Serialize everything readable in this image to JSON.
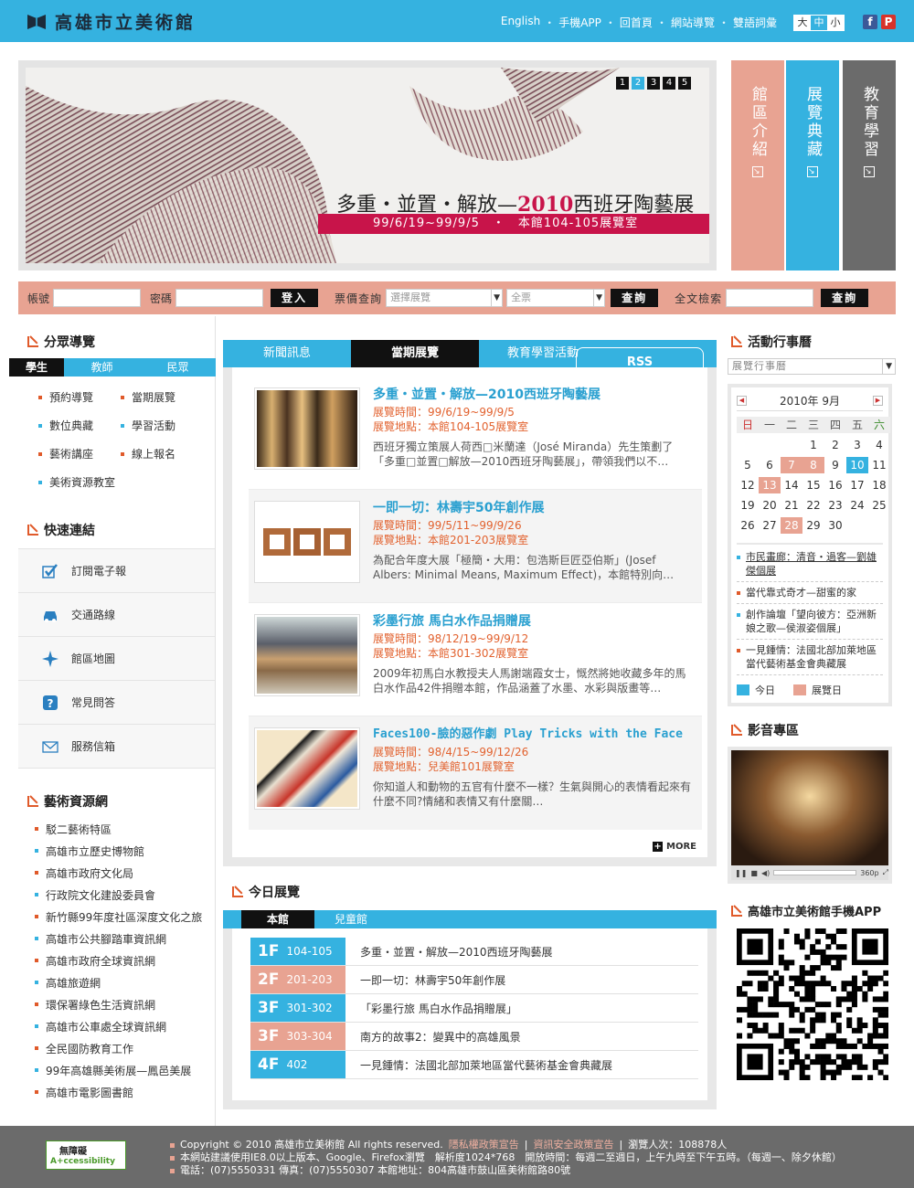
{
  "header": {
    "logo_text": "高雄市立美術館",
    "nav": [
      "English",
      "手機APP",
      "回首頁",
      "網站導覽",
      "雙語詞彙"
    ],
    "font_sizes": [
      "大",
      "中",
      "小"
    ],
    "social": [
      "f",
      "P"
    ]
  },
  "banner": {
    "pages": [
      "1",
      "2",
      "3",
      "4",
      "5"
    ],
    "active_page": "2",
    "title_prefix": "多重・並置・解放—",
    "title_year": "2010",
    "title_suffix": "西班牙陶藝展",
    "subtitle": "99/6/19~99/9/5　・　本館104-105展覽室"
  },
  "side_tiles": [
    {
      "label": "館區介紹",
      "color": "#e8a392"
    },
    {
      "label": "展覽典藏",
      "color": "#35b2e0"
    },
    {
      "label": "教育學習",
      "color": "#6b6b6b"
    }
  ],
  "searchbar": {
    "account_label": "帳號",
    "password_label": "密碼",
    "login_btn": "登入",
    "ticket_label": "票價查詢",
    "exhibit_select": "選擇展覽",
    "ticket_select": "全票",
    "query_btn": "查詢",
    "fulltext_label": "全文檢索",
    "fulltext_btn": "查詢"
  },
  "audience": {
    "title": "分眾導覽",
    "tabs": [
      "學生",
      "教師",
      "民眾"
    ],
    "links": [
      {
        "label": "預約導覽",
        "color": "#e05a2a"
      },
      {
        "label": "當期展覽",
        "color": "#e05a2a"
      },
      {
        "label": "數位典藏",
        "color": "#35b2e0"
      },
      {
        "label": "學習活動",
        "color": "#35b2e0"
      },
      {
        "label": "藝術講座",
        "color": "#e05a2a"
      },
      {
        "label": "線上報名",
        "color": "#e05a2a"
      },
      {
        "label": "美術資源教室",
        "color": "#35b2e0"
      }
    ]
  },
  "quick": {
    "title": "快速連結",
    "items": [
      "訂閱電子報",
      "交通路線",
      "館區地圖",
      "常見問答",
      "服務信箱"
    ]
  },
  "resources": {
    "title": "藝術資源網",
    "items": [
      {
        "label": "駁二藝術特區",
        "color": "#e05a2a"
      },
      {
        "label": "高雄市立歷史博物館",
        "color": "#35b2e0"
      },
      {
        "label": "高雄市政府文化局",
        "color": "#e05a2a"
      },
      {
        "label": "行政院文化建設委員會",
        "color": "#35b2e0"
      },
      {
        "label": "新竹縣99年度社區深度文化之旅",
        "color": "#e05a2a"
      },
      {
        "label": "高雄市公共腳踏車資訊網",
        "color": "#35b2e0"
      },
      {
        "label": "高雄市政府全球資訊網",
        "color": "#e05a2a"
      },
      {
        "label": "高雄旅遊網",
        "color": "#35b2e0"
      },
      {
        "label": "環保署綠色生活資訊網",
        "color": "#e05a2a"
      },
      {
        "label": "高雄市公車處全球資訊網",
        "color": "#35b2e0"
      },
      {
        "label": "全民國防教育工作",
        "color": "#e05a2a"
      },
      {
        "label": "99年高雄縣美術展—鳳邑美展",
        "color": "#35b2e0"
      },
      {
        "label": "高雄市電影圖書館",
        "color": "#e05a2a"
      }
    ]
  },
  "news_tabs": [
    "新聞訊息",
    "當期展覽",
    "教育學習活動"
  ],
  "news_active": "當期展覽",
  "rss": "RSS",
  "news": [
    {
      "title": "多重・並置・解放—2010西班牙陶藝展",
      "time": "展覽時間：99/6/19~99/9/5",
      "place": "展覽地點：本館104-105展覽室",
      "desc": "西班牙獨立策展人荷西□米蘭達（José Miranda）先生策劃了「多重□並置□解放—2010西班牙陶藝展」，帶領我們以不…"
    },
    {
      "title": "一即一切：林壽宇50年創作展",
      "time": "展覽時間：99/5/11~99/9/26",
      "place": "展覽地點：本館201-203展覽室",
      "desc": "為配合年度大展「極簡・大用：包浩斯巨匠亞伯斯」(Josef Albers: Minimal Means, Maximum Effect)，本館特別向…"
    },
    {
      "title": "彩墨行旅 馬白水作品捐贈展",
      "time": "展覽時間：98/12/19~99/9/12",
      "place": "展覽地點：本館301-302展覽室",
      "desc": "2009年初馬白水教授夫人馬謝端霞女士，慨然將她收藏多年的馬白水作品42件捐贈本館，作品涵蓋了水墨、水彩與版畫等…"
    },
    {
      "title": "Faces100-臉的惡作劇 Play Tricks with the Face",
      "time": "展覽時間：98/4/15~99/12/26",
      "place": "展覽地點：兒美館101展覽室",
      "desc": "你知道人和動物的五官有什麼不一樣？生氣與開心的表情看起來有什麼不同?情緒和表情又有什麼關…"
    }
  ],
  "more": "MORE",
  "today": {
    "title": "今日展覽",
    "tabs": [
      "本館",
      "兒童館"
    ],
    "floors": [
      {
        "floor": "1F",
        "room": "104-105",
        "name": "多重・並置・解放—2010西班牙陶藝展",
        "color": "#35b2e0"
      },
      {
        "floor": "2F",
        "room": "201-203",
        "name": "一即一切：林壽宇50年創作展",
        "color": "#e8a392"
      },
      {
        "floor": "3F",
        "room": "301-302",
        "name": "「彩墨行旅 馬白水作品捐贈展」",
        "color": "#35b2e0"
      },
      {
        "floor": "3F",
        "room": "303-304",
        "name": "南方的故事2：變異中的高雄風景",
        "color": "#e8a392"
      },
      {
        "floor": "4F",
        "room": "402",
        "name": "一見鍾情：法國北部加萊地區當代藝術基金會典藏展",
        "color": "#35b2e0"
      }
    ]
  },
  "calendar": {
    "title": "活動行事曆",
    "select": "展覽行事曆",
    "month": "2010年 9月",
    "weekdays": [
      "日",
      "一",
      "二",
      "三",
      "四",
      "五",
      "六"
    ],
    "days": [
      "",
      "",
      "",
      "1",
      "2",
      "3",
      "4",
      "5",
      "6",
      "7",
      "8",
      "9",
      "10",
      "11",
      "12",
      "13",
      "14",
      "15",
      "16",
      "17",
      "18",
      "19",
      "20",
      "21",
      "22",
      "23",
      "24",
      "25",
      "26",
      "27",
      "28",
      "29",
      "30",
      "",
      ""
    ],
    "today_day": "10",
    "exhibit_days": [
      "7",
      "8",
      "13",
      "28"
    ],
    "events": [
      {
        "label": "市民畫廊：清音・過客—劉雄傑個展",
        "color": "#35b2e0"
      },
      {
        "label": "當代靠式奇才—甜蜜的家",
        "color": "#e05a2a"
      },
      {
        "label": "創作論壇「望向彼方：亞洲新娘之歌—侯淑姿個展」",
        "color": "#35b2e0"
      },
      {
        "label": "一見鍾情：法國北部加萊地區當代藝術基金會典藏展",
        "color": "#e05a2a"
      }
    ],
    "legend_today": "今日",
    "legend_exhibit": "展覽日"
  },
  "video": {
    "title": "影音專區",
    "quality": "360p"
  },
  "app": {
    "title": "高雄市立美術館手機APP"
  },
  "footer": {
    "badge_line1": "無障礙",
    "badge_line2": "A+ccessibility",
    "copyright": "Copyright © 2010 高雄市立美術館 All rights reserved.",
    "privacy": "隱私權政策宣告",
    "security": "資訊安全政策宣告",
    "visits": "瀏覽人次：108878人",
    "line2": "本網站建議使用IE8.0以上版本、Google、Firefox瀏覽　解析度1024*768　開放時間：每週二至週日，上午九時至下午五時。（每週一、除夕休館）",
    "line3": "電話：(07)5550331 傳真：(07)5550307 本館地址：804高雄市鼓山區美術館路80號"
  },
  "colors": {
    "accent": "#35b2e0",
    "salmon": "#e8a392",
    "orange": "#e05a2a",
    "gray": "#6b6b6b"
  }
}
